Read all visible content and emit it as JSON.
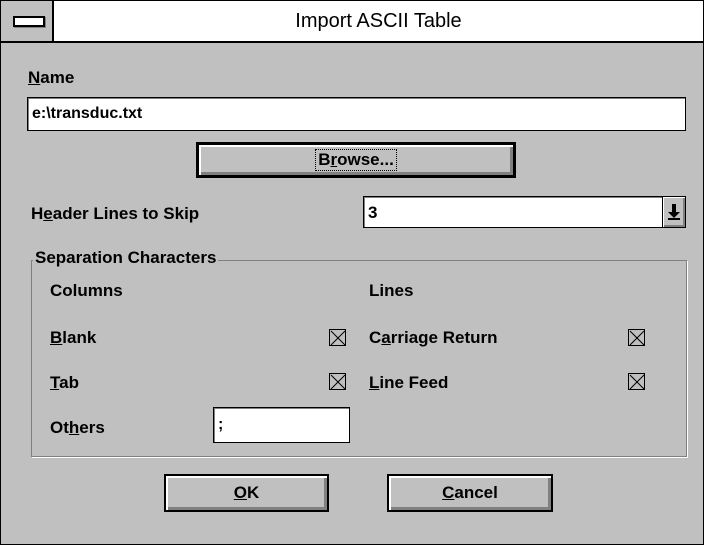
{
  "window": {
    "title": "Import ASCII Table"
  },
  "name": {
    "label": "Name",
    "hotkey": "N",
    "value": "e:\\transduc.txt"
  },
  "browse": {
    "label": "Browse..."
  },
  "header_lines": {
    "label_pre": "H",
    "label_hot": "e",
    "label_post": "ader Lines to Skip",
    "value": "3"
  },
  "separation": {
    "title": "Separation Characters",
    "columns_heading": "Columns",
    "lines_heading": "Lines",
    "blank": {
      "hot": "B",
      "rest": "lank",
      "checked": true
    },
    "tab": {
      "hot": "T",
      "rest": "ab",
      "checked": true
    },
    "others": {
      "pre": "Ot",
      "hot": "h",
      "post": "ers",
      "value": ";"
    },
    "carriage_return": {
      "pre": "C",
      "hot": "a",
      "post": "rriage Return",
      "checked": true
    },
    "line_feed": {
      "hot": "L",
      "rest": "ine Feed",
      "checked": true
    }
  },
  "ok": {
    "hot": "O",
    "rest": "K"
  },
  "cancel": {
    "hot": "C",
    "rest": "ancel"
  }
}
